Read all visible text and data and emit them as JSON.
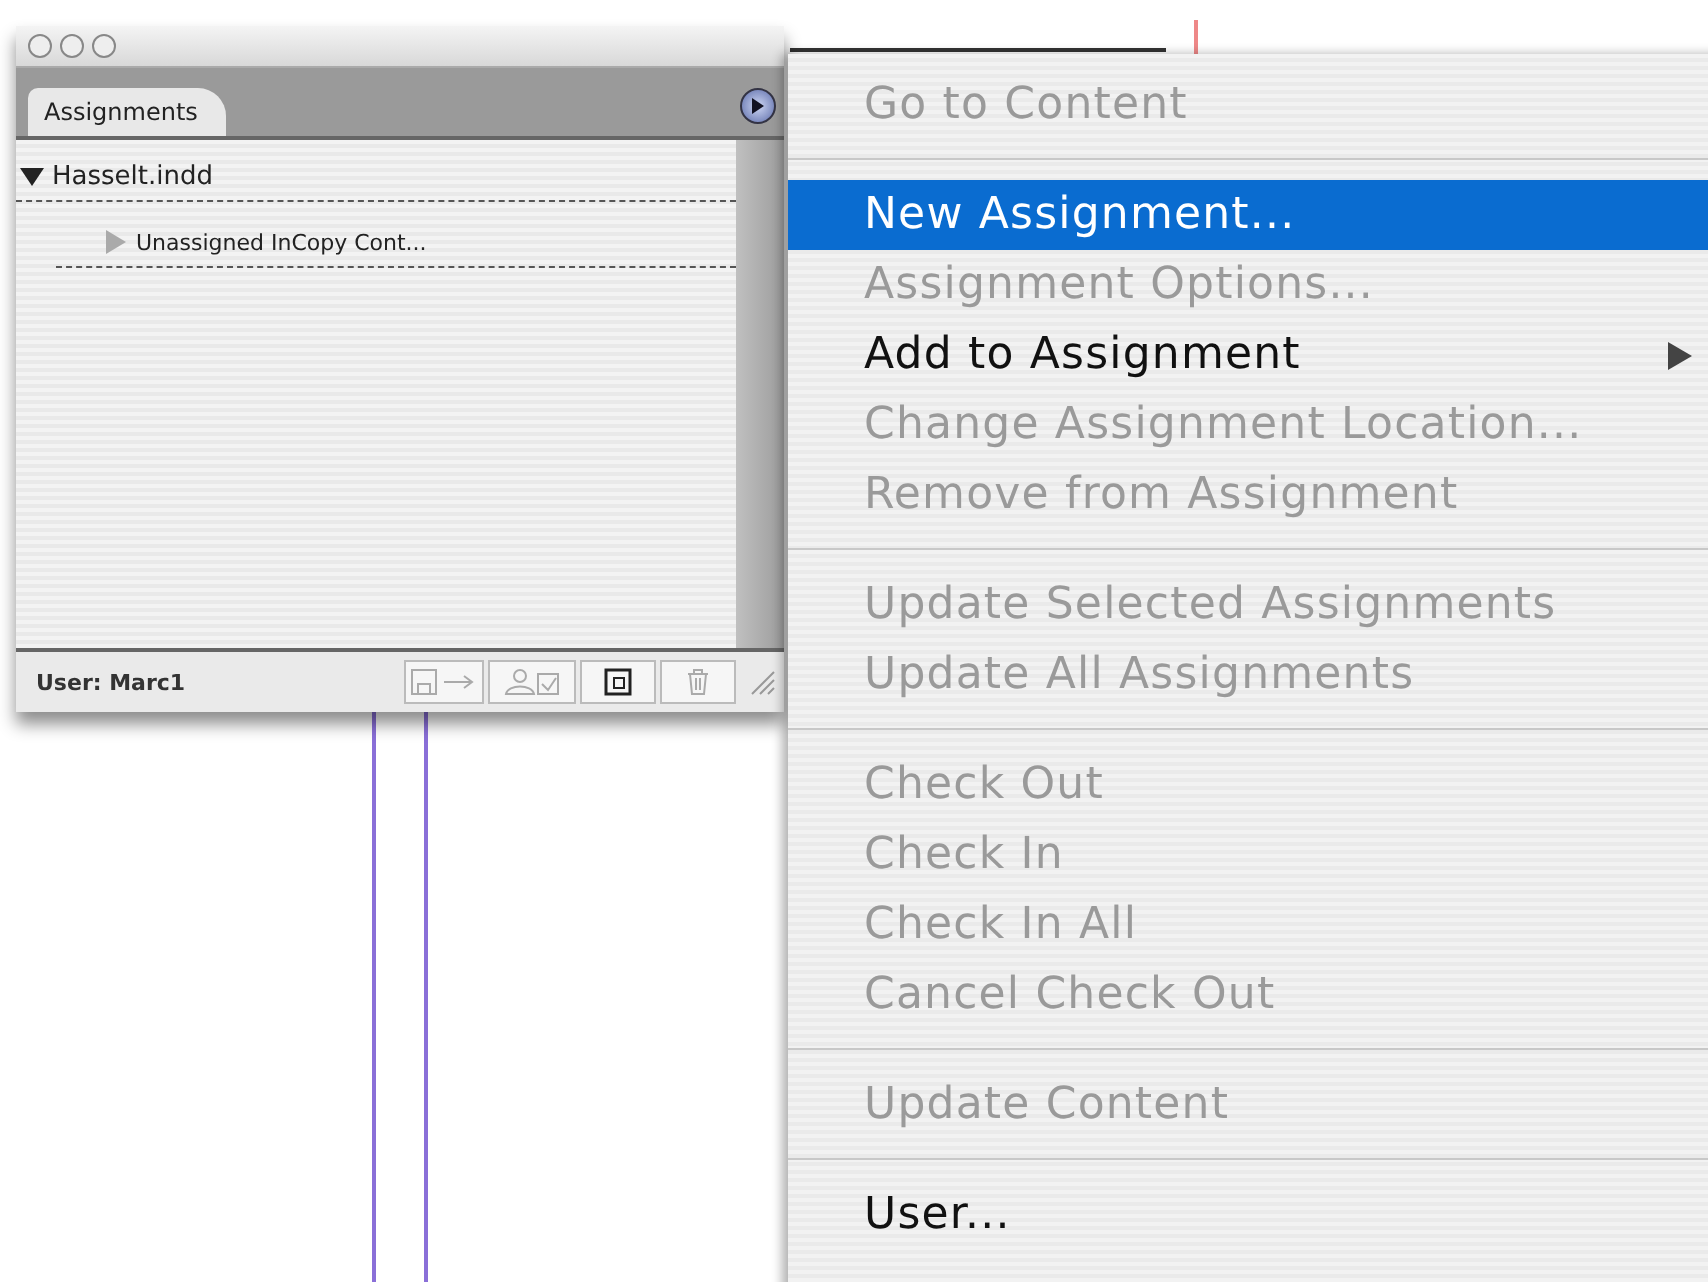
{
  "panel": {
    "tab": {
      "label": "Assignments",
      "selected": true
    },
    "tree": [
      {
        "label": "Hasselt.indd",
        "expanded": true,
        "children": [
          {
            "label": "Unassigned InCopy Cont...",
            "expanded": false
          }
        ]
      }
    ],
    "user_label": "User: Marc1",
    "buttons": [
      {
        "kind": "save-forward",
        "disabled": true
      },
      {
        "kind": "assign",
        "disabled": true
      },
      {
        "kind": "new",
        "disabled": false
      },
      {
        "kind": "trash",
        "disabled": true
      }
    ]
  },
  "menu": {
    "groups": [
      [
        {
          "label": "Go to Content",
          "kind": "command",
          "disabled": true,
          "selected": false
        }
      ],
      [
        {
          "label": "New Assignment...",
          "kind": "command",
          "disabled": false,
          "selected": true
        },
        {
          "label": "Assignment Options...",
          "kind": "command",
          "disabled": true,
          "selected": false
        },
        {
          "label": "Add to Assignment",
          "kind": "submenu",
          "disabled": false,
          "selected": false
        },
        {
          "label": "Change Assignment Location...",
          "kind": "command",
          "disabled": true,
          "selected": false
        },
        {
          "label": "Remove from Assignment",
          "kind": "command",
          "disabled": true,
          "selected": false
        }
      ],
      [
        {
          "label": "Update Selected Assignments",
          "kind": "command",
          "disabled": true,
          "selected": false
        },
        {
          "label": "Update All Assignments",
          "kind": "command",
          "disabled": true,
          "selected": false
        }
      ],
      [
        {
          "label": "Check Out",
          "kind": "command",
          "disabled": true,
          "selected": false
        },
        {
          "label": "Check In",
          "kind": "command",
          "disabled": true,
          "selected": false
        },
        {
          "label": "Check In All",
          "kind": "command",
          "disabled": true,
          "selected": false
        },
        {
          "label": "Cancel Check Out",
          "kind": "command",
          "disabled": true,
          "selected": false
        }
      ],
      [
        {
          "label": "Update Content",
          "kind": "command",
          "disabled": true,
          "selected": false
        }
      ],
      [
        {
          "label": "User...",
          "kind": "command",
          "disabled": false,
          "selected": false
        }
      ]
    ]
  }
}
